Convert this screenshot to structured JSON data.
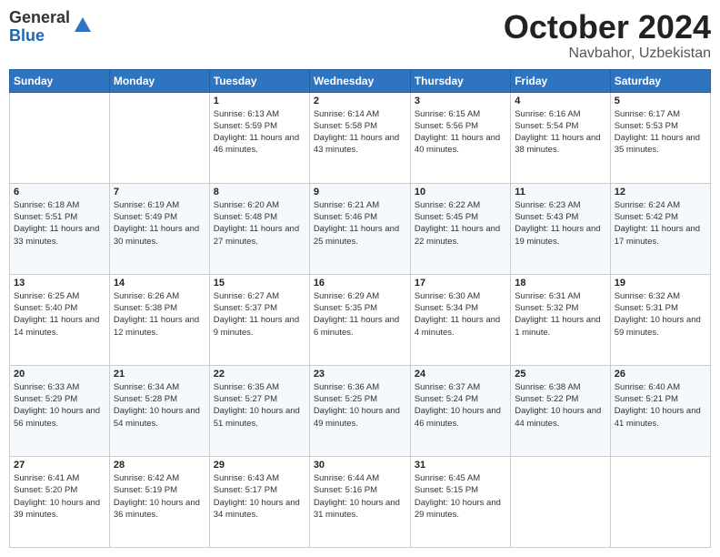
{
  "logo": {
    "general": "General",
    "blue": "Blue"
  },
  "header": {
    "month": "October 2024",
    "location": "Navbahor, Uzbekistan"
  },
  "weekdays": [
    "Sunday",
    "Monday",
    "Tuesday",
    "Wednesday",
    "Thursday",
    "Friday",
    "Saturday"
  ],
  "weeks": [
    [
      {
        "day": "",
        "info": ""
      },
      {
        "day": "",
        "info": ""
      },
      {
        "day": "1",
        "info": "Sunrise: 6:13 AM\nSunset: 5:59 PM\nDaylight: 11 hours and 46 minutes."
      },
      {
        "day": "2",
        "info": "Sunrise: 6:14 AM\nSunset: 5:58 PM\nDaylight: 11 hours and 43 minutes."
      },
      {
        "day": "3",
        "info": "Sunrise: 6:15 AM\nSunset: 5:56 PM\nDaylight: 11 hours and 40 minutes."
      },
      {
        "day": "4",
        "info": "Sunrise: 6:16 AM\nSunset: 5:54 PM\nDaylight: 11 hours and 38 minutes."
      },
      {
        "day": "5",
        "info": "Sunrise: 6:17 AM\nSunset: 5:53 PM\nDaylight: 11 hours and 35 minutes."
      }
    ],
    [
      {
        "day": "6",
        "info": "Sunrise: 6:18 AM\nSunset: 5:51 PM\nDaylight: 11 hours and 33 minutes."
      },
      {
        "day": "7",
        "info": "Sunrise: 6:19 AM\nSunset: 5:49 PM\nDaylight: 11 hours and 30 minutes."
      },
      {
        "day": "8",
        "info": "Sunrise: 6:20 AM\nSunset: 5:48 PM\nDaylight: 11 hours and 27 minutes."
      },
      {
        "day": "9",
        "info": "Sunrise: 6:21 AM\nSunset: 5:46 PM\nDaylight: 11 hours and 25 minutes."
      },
      {
        "day": "10",
        "info": "Sunrise: 6:22 AM\nSunset: 5:45 PM\nDaylight: 11 hours and 22 minutes."
      },
      {
        "day": "11",
        "info": "Sunrise: 6:23 AM\nSunset: 5:43 PM\nDaylight: 11 hours and 19 minutes."
      },
      {
        "day": "12",
        "info": "Sunrise: 6:24 AM\nSunset: 5:42 PM\nDaylight: 11 hours and 17 minutes."
      }
    ],
    [
      {
        "day": "13",
        "info": "Sunrise: 6:25 AM\nSunset: 5:40 PM\nDaylight: 11 hours and 14 minutes."
      },
      {
        "day": "14",
        "info": "Sunrise: 6:26 AM\nSunset: 5:38 PM\nDaylight: 11 hours and 12 minutes."
      },
      {
        "day": "15",
        "info": "Sunrise: 6:27 AM\nSunset: 5:37 PM\nDaylight: 11 hours and 9 minutes."
      },
      {
        "day": "16",
        "info": "Sunrise: 6:29 AM\nSunset: 5:35 PM\nDaylight: 11 hours and 6 minutes."
      },
      {
        "day": "17",
        "info": "Sunrise: 6:30 AM\nSunset: 5:34 PM\nDaylight: 11 hours and 4 minutes."
      },
      {
        "day": "18",
        "info": "Sunrise: 6:31 AM\nSunset: 5:32 PM\nDaylight: 11 hours and 1 minute."
      },
      {
        "day": "19",
        "info": "Sunrise: 6:32 AM\nSunset: 5:31 PM\nDaylight: 10 hours and 59 minutes."
      }
    ],
    [
      {
        "day": "20",
        "info": "Sunrise: 6:33 AM\nSunset: 5:29 PM\nDaylight: 10 hours and 56 minutes."
      },
      {
        "day": "21",
        "info": "Sunrise: 6:34 AM\nSunset: 5:28 PM\nDaylight: 10 hours and 54 minutes."
      },
      {
        "day": "22",
        "info": "Sunrise: 6:35 AM\nSunset: 5:27 PM\nDaylight: 10 hours and 51 minutes."
      },
      {
        "day": "23",
        "info": "Sunrise: 6:36 AM\nSunset: 5:25 PM\nDaylight: 10 hours and 49 minutes."
      },
      {
        "day": "24",
        "info": "Sunrise: 6:37 AM\nSunset: 5:24 PM\nDaylight: 10 hours and 46 minutes."
      },
      {
        "day": "25",
        "info": "Sunrise: 6:38 AM\nSunset: 5:22 PM\nDaylight: 10 hours and 44 minutes."
      },
      {
        "day": "26",
        "info": "Sunrise: 6:40 AM\nSunset: 5:21 PM\nDaylight: 10 hours and 41 minutes."
      }
    ],
    [
      {
        "day": "27",
        "info": "Sunrise: 6:41 AM\nSunset: 5:20 PM\nDaylight: 10 hours and 39 minutes."
      },
      {
        "day": "28",
        "info": "Sunrise: 6:42 AM\nSunset: 5:19 PM\nDaylight: 10 hours and 36 minutes."
      },
      {
        "day": "29",
        "info": "Sunrise: 6:43 AM\nSunset: 5:17 PM\nDaylight: 10 hours and 34 minutes."
      },
      {
        "day": "30",
        "info": "Sunrise: 6:44 AM\nSunset: 5:16 PM\nDaylight: 10 hours and 31 minutes."
      },
      {
        "day": "31",
        "info": "Sunrise: 6:45 AM\nSunset: 5:15 PM\nDaylight: 10 hours and 29 minutes."
      },
      {
        "day": "",
        "info": ""
      },
      {
        "day": "",
        "info": ""
      }
    ]
  ]
}
